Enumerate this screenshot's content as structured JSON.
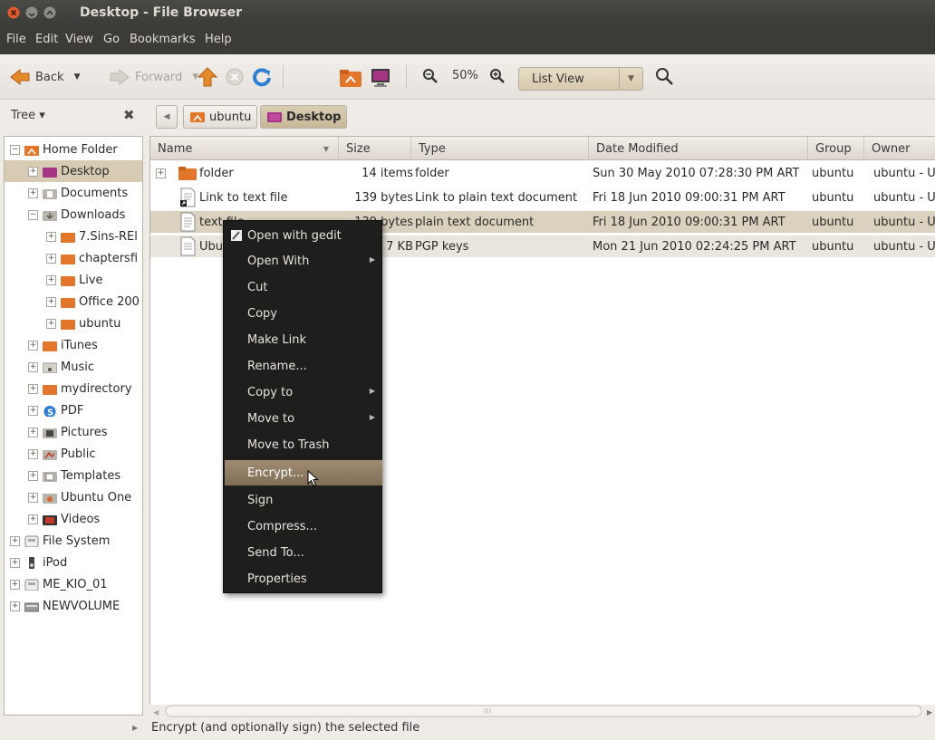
{
  "window": {
    "title": "Desktop - File Browser"
  },
  "menubar": {
    "items": [
      "File",
      "Edit",
      "View",
      "Go",
      "Bookmarks",
      "Help"
    ]
  },
  "toolbar": {
    "back_label": "Back",
    "forward_label": "Forward",
    "zoom_value": "50%",
    "view_mode": "List View"
  },
  "location": {
    "tree_label": "Tree ▾",
    "crumbs": [
      "ubuntu",
      "Desktop"
    ]
  },
  "sidebar": {
    "items": [
      {
        "label": "Home Folder",
        "expander": "−",
        "icon": "home-folder"
      },
      {
        "label": "Desktop",
        "expander": "+",
        "icon": "desktop"
      },
      {
        "label": "Documents",
        "expander": "+",
        "icon": "documents"
      },
      {
        "label": "Downloads",
        "expander": "−",
        "icon": "downloads"
      },
      {
        "label": "7.Sins-REl",
        "expander": "+",
        "icon": "folder"
      },
      {
        "label": "chaptersfi",
        "expander": "+",
        "icon": "folder"
      },
      {
        "label": "Live",
        "expander": "+",
        "icon": "folder"
      },
      {
        "label": "Office 200",
        "expander": "+",
        "icon": "folder"
      },
      {
        "label": "ubuntu",
        "expander": "+",
        "icon": "folder"
      },
      {
        "label": "iTunes",
        "expander": "+",
        "icon": "folder"
      },
      {
        "label": "Music",
        "expander": "+",
        "icon": "music"
      },
      {
        "label": "mydirectory",
        "expander": "+",
        "icon": "folder"
      },
      {
        "label": "PDF",
        "expander": "+",
        "icon": "pdf"
      },
      {
        "label": "Pictures",
        "expander": "+",
        "icon": "pictures"
      },
      {
        "label": "Public",
        "expander": "+",
        "icon": "public"
      },
      {
        "label": "Templates",
        "expander": "+",
        "icon": "templates"
      },
      {
        "label": "Ubuntu One",
        "expander": "+",
        "icon": "ubuntu-one"
      },
      {
        "label": "Videos",
        "expander": "+",
        "icon": "videos"
      },
      {
        "label": "File System",
        "expander": "+",
        "icon": "drive"
      },
      {
        "label": "iPod",
        "expander": "+",
        "icon": "ipod"
      },
      {
        "label": "ME_KIO_01",
        "expander": "+",
        "icon": "drive"
      },
      {
        "label": "NEWVOLUME",
        "expander": "+",
        "icon": "volume"
      }
    ]
  },
  "filelist": {
    "columns": [
      "Name",
      "Size",
      "Type",
      "Date Modified",
      "Group",
      "Owner"
    ],
    "rows": [
      {
        "name": "folder",
        "size": "14 items",
        "type": "folder",
        "date": "Sun 30 May 2010 07:28:30 PM ART",
        "group": "ubuntu",
        "owner": "ubuntu - U"
      },
      {
        "name": "Link to text file",
        "size": "139 bytes",
        "type": "Link to plain text document",
        "date": "Fri 18 Jun 2010 09:00:31 PM ART",
        "group": "ubuntu",
        "owner": "ubuntu - U"
      },
      {
        "name": "text file",
        "size": "139 bytes",
        "type": "plain text document",
        "date": "Fri 18 Jun 2010 09:00:31 PM ART",
        "group": "ubuntu",
        "owner": "ubuntu - U"
      },
      {
        "name": "Ubu",
        "size": "7 KB",
        "type": "PGP keys",
        "date": "Mon 21 Jun 2010 02:24:25 PM ART",
        "group": "ubuntu",
        "owner": "ubuntu - U"
      }
    ]
  },
  "context_menu": {
    "items": [
      {
        "label": "Open with gedit",
        "submenu": false
      },
      {
        "label": "Open With",
        "submenu": true
      },
      {
        "label": "Cut",
        "submenu": false
      },
      {
        "label": "Copy",
        "submenu": false
      },
      {
        "label": "Make Link",
        "submenu": false
      },
      {
        "label": "Rename...",
        "submenu": false
      },
      {
        "label": "Copy to",
        "submenu": true
      },
      {
        "label": "Move to",
        "submenu": true
      },
      {
        "label": "Move to Trash",
        "submenu": false
      },
      {
        "label": "Encrypt...",
        "submenu": false,
        "highlighted": true
      },
      {
        "label": "Sign",
        "submenu": false
      },
      {
        "label": "Compress...",
        "submenu": false
      },
      {
        "label": "Send To...",
        "submenu": false
      },
      {
        "label": "Properties",
        "submenu": false
      }
    ]
  },
  "status": {
    "text": "Encrypt (and optionally sign) the selected file"
  },
  "colors": {
    "accent": "#d7cbb3",
    "menu_bg": "#1e1e1c",
    "highlight": "#8f7c63",
    "folder": "#e2762a"
  }
}
